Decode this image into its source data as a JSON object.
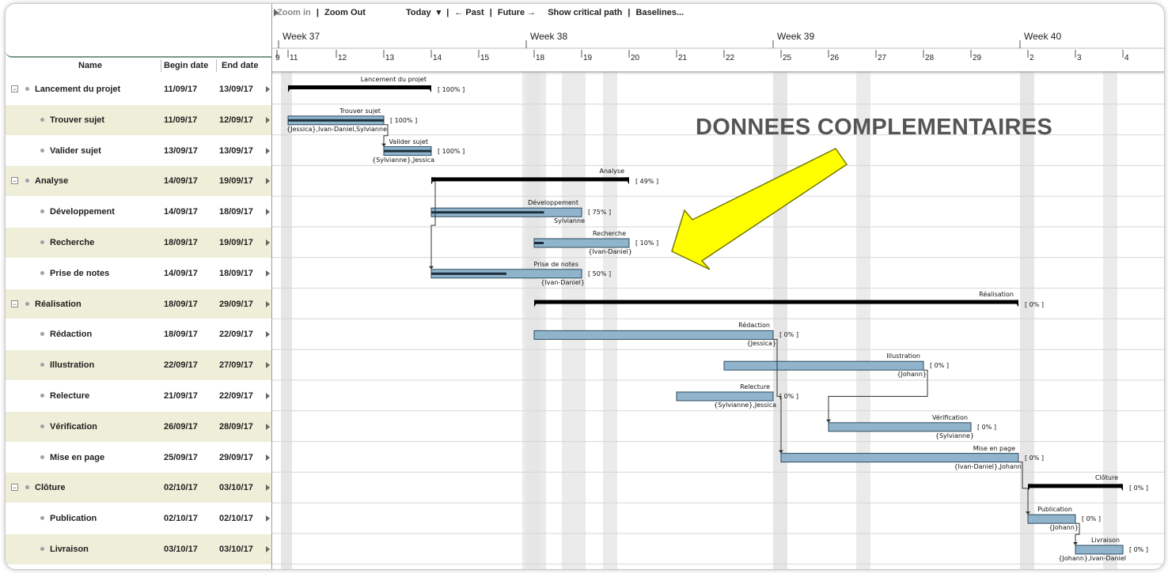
{
  "toolbar": {
    "zoom_in": "Zoom in",
    "zoom_out": "Zoom Out",
    "today": "Today",
    "past": "← Past",
    "future": "Future →",
    "critical_path": "Show critical path",
    "baselines": "Baselines..."
  },
  "columns": {
    "name": "Name",
    "begin": "Begin date",
    "end": "End date"
  },
  "weeks": [
    "Week 37",
    "Week 38",
    "Week 39",
    "Week 40"
  ],
  "days": [
    "9",
    "11",
    "12",
    "13",
    "14",
    "15",
    "18",
    "19",
    "20",
    "21",
    "22",
    "25",
    "26",
    "27",
    "28",
    "29",
    "2",
    "3",
    "4"
  ],
  "tasks": [
    {
      "name": "Lancement du projet",
      "begin": "11/09/17",
      "end": "13/09/17",
      "group": true,
      "title": "Lancement du projet",
      "pct": "[ 100% ]",
      "res": ""
    },
    {
      "name": "Trouver sujet",
      "begin": "11/09/17",
      "end": "12/09/17",
      "group": false,
      "title": "Trouver sujet",
      "pct": "[ 100% ]",
      "res": "{Jessica},Ivan-Daniel,Sylvianne"
    },
    {
      "name": "Valider sujet",
      "begin": "13/09/17",
      "end": "13/09/17",
      "group": false,
      "title": "Valider sujet",
      "pct": "[ 100% ]",
      "res": "{Sylvianne},Jessica"
    },
    {
      "name": "Analyse",
      "begin": "14/09/17",
      "end": "19/09/17",
      "group": true,
      "title": "Analyse",
      "pct": "[ 49% ]",
      "res": ""
    },
    {
      "name": "Développement",
      "begin": "14/09/17",
      "end": "18/09/17",
      "group": false,
      "title": "Développement",
      "pct": "[ 75% ]",
      "res": "Sylvianne"
    },
    {
      "name": "Recherche",
      "begin": "18/09/17",
      "end": "19/09/17",
      "group": false,
      "title": "Recherche",
      "pct": "[ 10% ]",
      "res": "{Ivan-Daniel}"
    },
    {
      "name": "Prise de notes",
      "begin": "14/09/17",
      "end": "18/09/17",
      "group": false,
      "title": "Prise de notes",
      "pct": "[ 50% ]",
      "res": "{Ivan-Daniel}"
    },
    {
      "name": "Réalisation",
      "begin": "18/09/17",
      "end": "29/09/17",
      "group": true,
      "title": "Réalisation",
      "pct": "[ 0% ]",
      "res": ""
    },
    {
      "name": "Rédaction",
      "begin": "18/09/17",
      "end": "22/09/17",
      "group": false,
      "title": "Rédaction",
      "pct": "[ 0% ]",
      "res": "{Jessica}"
    },
    {
      "name": "Illustration",
      "begin": "22/09/17",
      "end": "27/09/17",
      "group": false,
      "title": "Illustration",
      "pct": "[ 0% ]",
      "res": "{Johann}"
    },
    {
      "name": "Relecture",
      "begin": "21/09/17",
      "end": "22/09/17",
      "group": false,
      "title": "Relecture",
      "pct": "[ 0% ]",
      "res": "{Sylvianne},Jessica"
    },
    {
      "name": "Vérification",
      "begin": "26/09/17",
      "end": "28/09/17",
      "group": false,
      "title": "Vérification",
      "pct": "[ 0% ]",
      "res": "{Sylvianne}"
    },
    {
      "name": "Mise en page",
      "begin": "25/09/17",
      "end": "29/09/17",
      "group": false,
      "title": "Mise en page",
      "pct": "[ 0% ]",
      "res": "{Ivan-Daniel},Johann"
    },
    {
      "name": "Clôture",
      "begin": "02/10/17",
      "end": "03/10/17",
      "group": true,
      "title": "Clôture",
      "pct": "[ 0% ]",
      "res": ""
    },
    {
      "name": "Publication",
      "begin": "02/10/17",
      "end": "02/10/17",
      "group": false,
      "title": "Publication",
      "pct": "[ 0% ]",
      "res": "{Johann}"
    },
    {
      "name": "Livraison",
      "begin": "03/10/17",
      "end": "03/10/17",
      "group": false,
      "title": "Livraison",
      "pct": "[ 0% ]",
      "res": "{Johann},Ivan-Daniel"
    }
  ],
  "annotation": "DONNEES COMPLEMENTAIRES",
  "colors": {
    "bar_fill": "#8fb4cc",
    "bar_border": "#2e4a5e",
    "summary": "#000000",
    "row_alt": "#eeeed9",
    "arrow": "#ffff00"
  }
}
